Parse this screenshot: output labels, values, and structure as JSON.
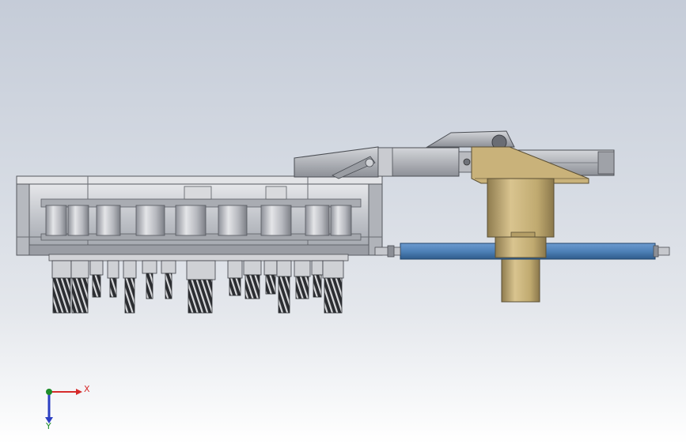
{
  "viewport": {
    "background_top": "#c5ccd8",
    "background_bottom": "#ffffff"
  },
  "model": {
    "colors": {
      "housing": "#cfd1d6",
      "housing_dark": "#8e939b",
      "tool": "#3a3c40",
      "arm": "#b4b6bb",
      "bracket": "#c9b27a",
      "shaft": "#c2ab75",
      "bar_blue": "#4e81b8"
    }
  },
  "triad": {
    "x_label": "X",
    "y_label": "Y",
    "x_color": "#d62b2b",
    "y_color": "#1d8c2a",
    "z_color": "#2c3fc2"
  }
}
